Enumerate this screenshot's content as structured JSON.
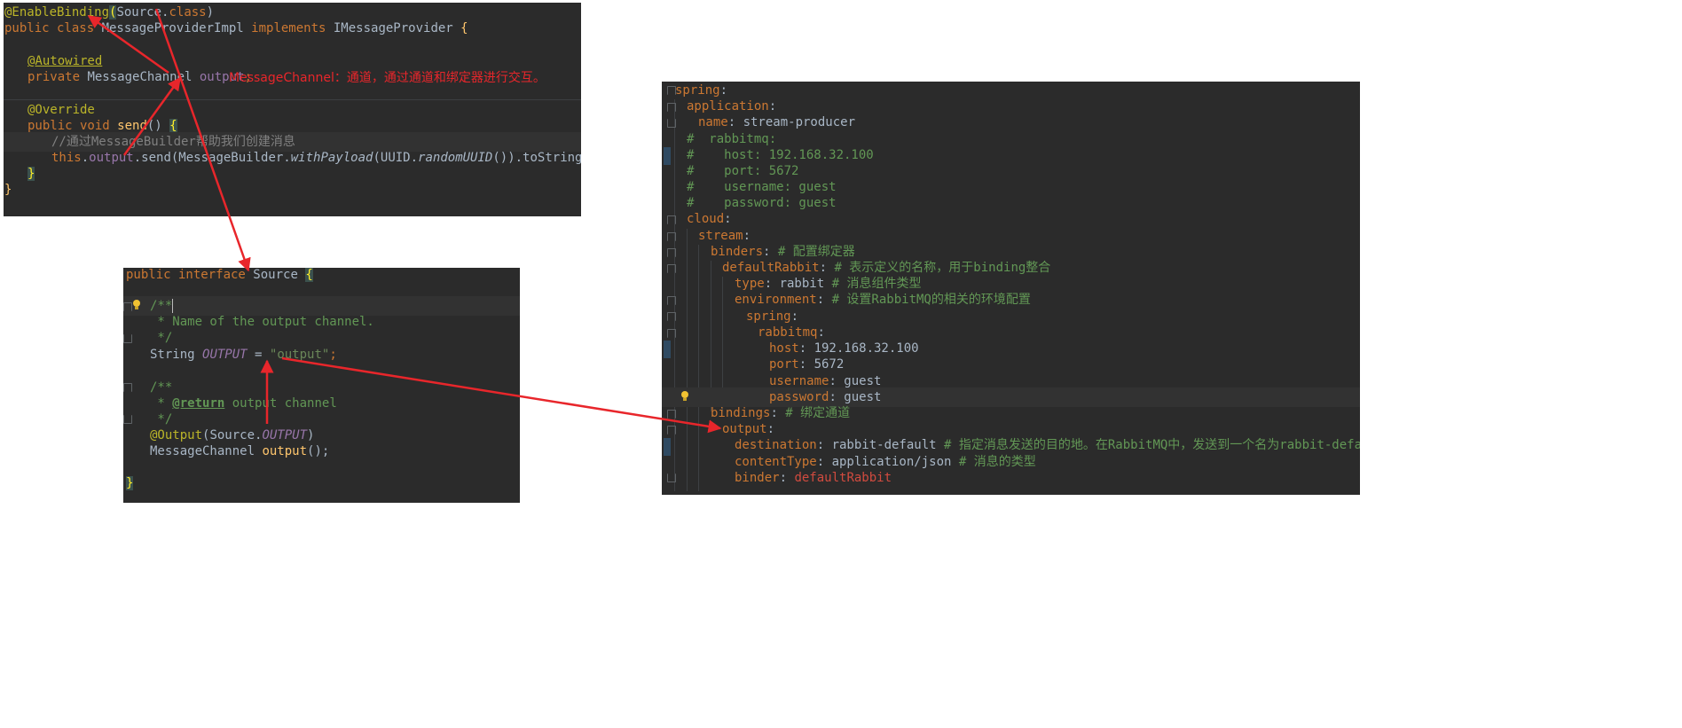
{
  "provider_panel": {
    "l1": {
      "annotation": "@EnableBinding",
      "open": "(",
      "cls": "Source",
      "dot": ".",
      "kw_class": "class",
      "close": ")"
    },
    "l2": {
      "kw_public_class": "public class ",
      "name": "MessageProviderImpl ",
      "kw_implements": "implements ",
      "iface": "IMessageProvider ",
      "brace": "{"
    },
    "l3": {
      "annotation": "@Autowired"
    },
    "l4": {
      "kw_private": "private ",
      "type": "MessageChannel ",
      "field": "output",
      "semi": ";"
    },
    "annotation_note": "MessageChannel：通道，通过通道和绑定器进行交互。",
    "l5": {
      "annotation": "@Override"
    },
    "l6": {
      "kw_public_void": "public void ",
      "method": "send",
      "parens": "() ",
      "brace": "{"
    },
    "l7": {
      "comment": "//通过MessageBuilder帮助我们创建消息"
    },
    "l8": {
      "kw_this": "this",
      "dot1": ".",
      "field": "output",
      "send": ".send(MessageBuilder.",
      "with_payload": "withPayload",
      "uuid": "(UUID.",
      "random_uuid": "randomUUID",
      "rest": "()).toString()).build());"
    },
    "l9": {
      "brace": "}"
    },
    "l10": {
      "brace": "}"
    }
  },
  "source_panel": {
    "l1": {
      "kw": "public interface ",
      "name": "Source ",
      "brace": "{"
    },
    "l2": {
      "doc": "/**"
    },
    "l3": {
      "doc": " * Name of the output channel."
    },
    "l4": {
      "doc": " */"
    },
    "l5": {
      "type": "String ",
      "constant": "OUTPUT",
      "eq": " = ",
      "value": "\"output\"",
      "semi": ";"
    },
    "l6": {
      "doc": "/**"
    },
    "l7": {
      "prefix": " * ",
      "tag": "@return",
      "text": " output channel"
    },
    "l8": {
      "doc": " */"
    },
    "l9": {
      "annotation": "@Output",
      "open": "(Source.",
      "constant": "OUTPUT",
      "close": ")"
    },
    "l10": {
      "type": "MessageChannel ",
      "method": "output",
      "rest": "();"
    },
    "l11": {
      "brace": "}"
    }
  },
  "yaml_panel": {
    "lines": [
      {
        "key": "spring",
        "colon": ":"
      },
      {
        "key": "application",
        "colon": ":"
      },
      {
        "key": "name",
        "colon": ": ",
        "value": "stream-producer"
      },
      {
        "comment": "#  rabbitmq:"
      },
      {
        "comment": "#    host: 192.168.32.100"
      },
      {
        "comment": "#    port: 5672"
      },
      {
        "comment": "#    username: guest"
      },
      {
        "comment": "#    password: guest"
      },
      {
        "key": "cloud",
        "colon": ":"
      },
      {
        "key": "stream",
        "colon": ":"
      },
      {
        "key": "binders",
        "colon": ": ",
        "comment": "# 配置绑定器"
      },
      {
        "key": "defaultRabbit",
        "colon": ": ",
        "comment": "# 表示定义的名称，用于binding整合"
      },
      {
        "key": "type",
        "colon": ": ",
        "value": "rabbit ",
        "comment": "# 消息组件类型"
      },
      {
        "key": "environment",
        "colon": ": ",
        "comment": "# 设置RabbitMQ的相关的环境配置"
      },
      {
        "key": "spring",
        "colon": ":"
      },
      {
        "key": "rabbitmq",
        "colon": ":"
      },
      {
        "key": "host",
        "colon": ": ",
        "value": "192.168.32.100"
      },
      {
        "key": "port",
        "colon": ": ",
        "value": "5672"
      },
      {
        "key": "username",
        "colon": ": ",
        "value": "guest"
      },
      {
        "key": "password",
        "colon": ": ",
        "value": "guest"
      },
      {
        "key": "bindings",
        "colon": ": ",
        "comment": "# 绑定通道"
      },
      {
        "key": "output",
        "colon": ":"
      },
      {
        "key": "destination",
        "colon": ": ",
        "value": "rabbit-default ",
        "comment": "# 指定消息发送的目的地。在RabbitMQ中，发送到一个名为rabbit-default的Exchange上。"
      },
      {
        "key": "contentType",
        "colon": ": ",
        "value": "application/json ",
        "comment": "# 消息的类型"
      },
      {
        "key": "binder",
        "colon": ": ",
        "ref": "defaultRabbit"
      }
    ]
  },
  "colors": {
    "editor_bg": "#2b2b2b",
    "keyword": "#cc7832",
    "annotation": "#bbb529",
    "string": "#6a8759",
    "arrow": "#e8262b",
    "note_text": "#e8262b"
  },
  "icons": [
    "lightbulb-icon",
    "fold-marker-icon"
  ]
}
